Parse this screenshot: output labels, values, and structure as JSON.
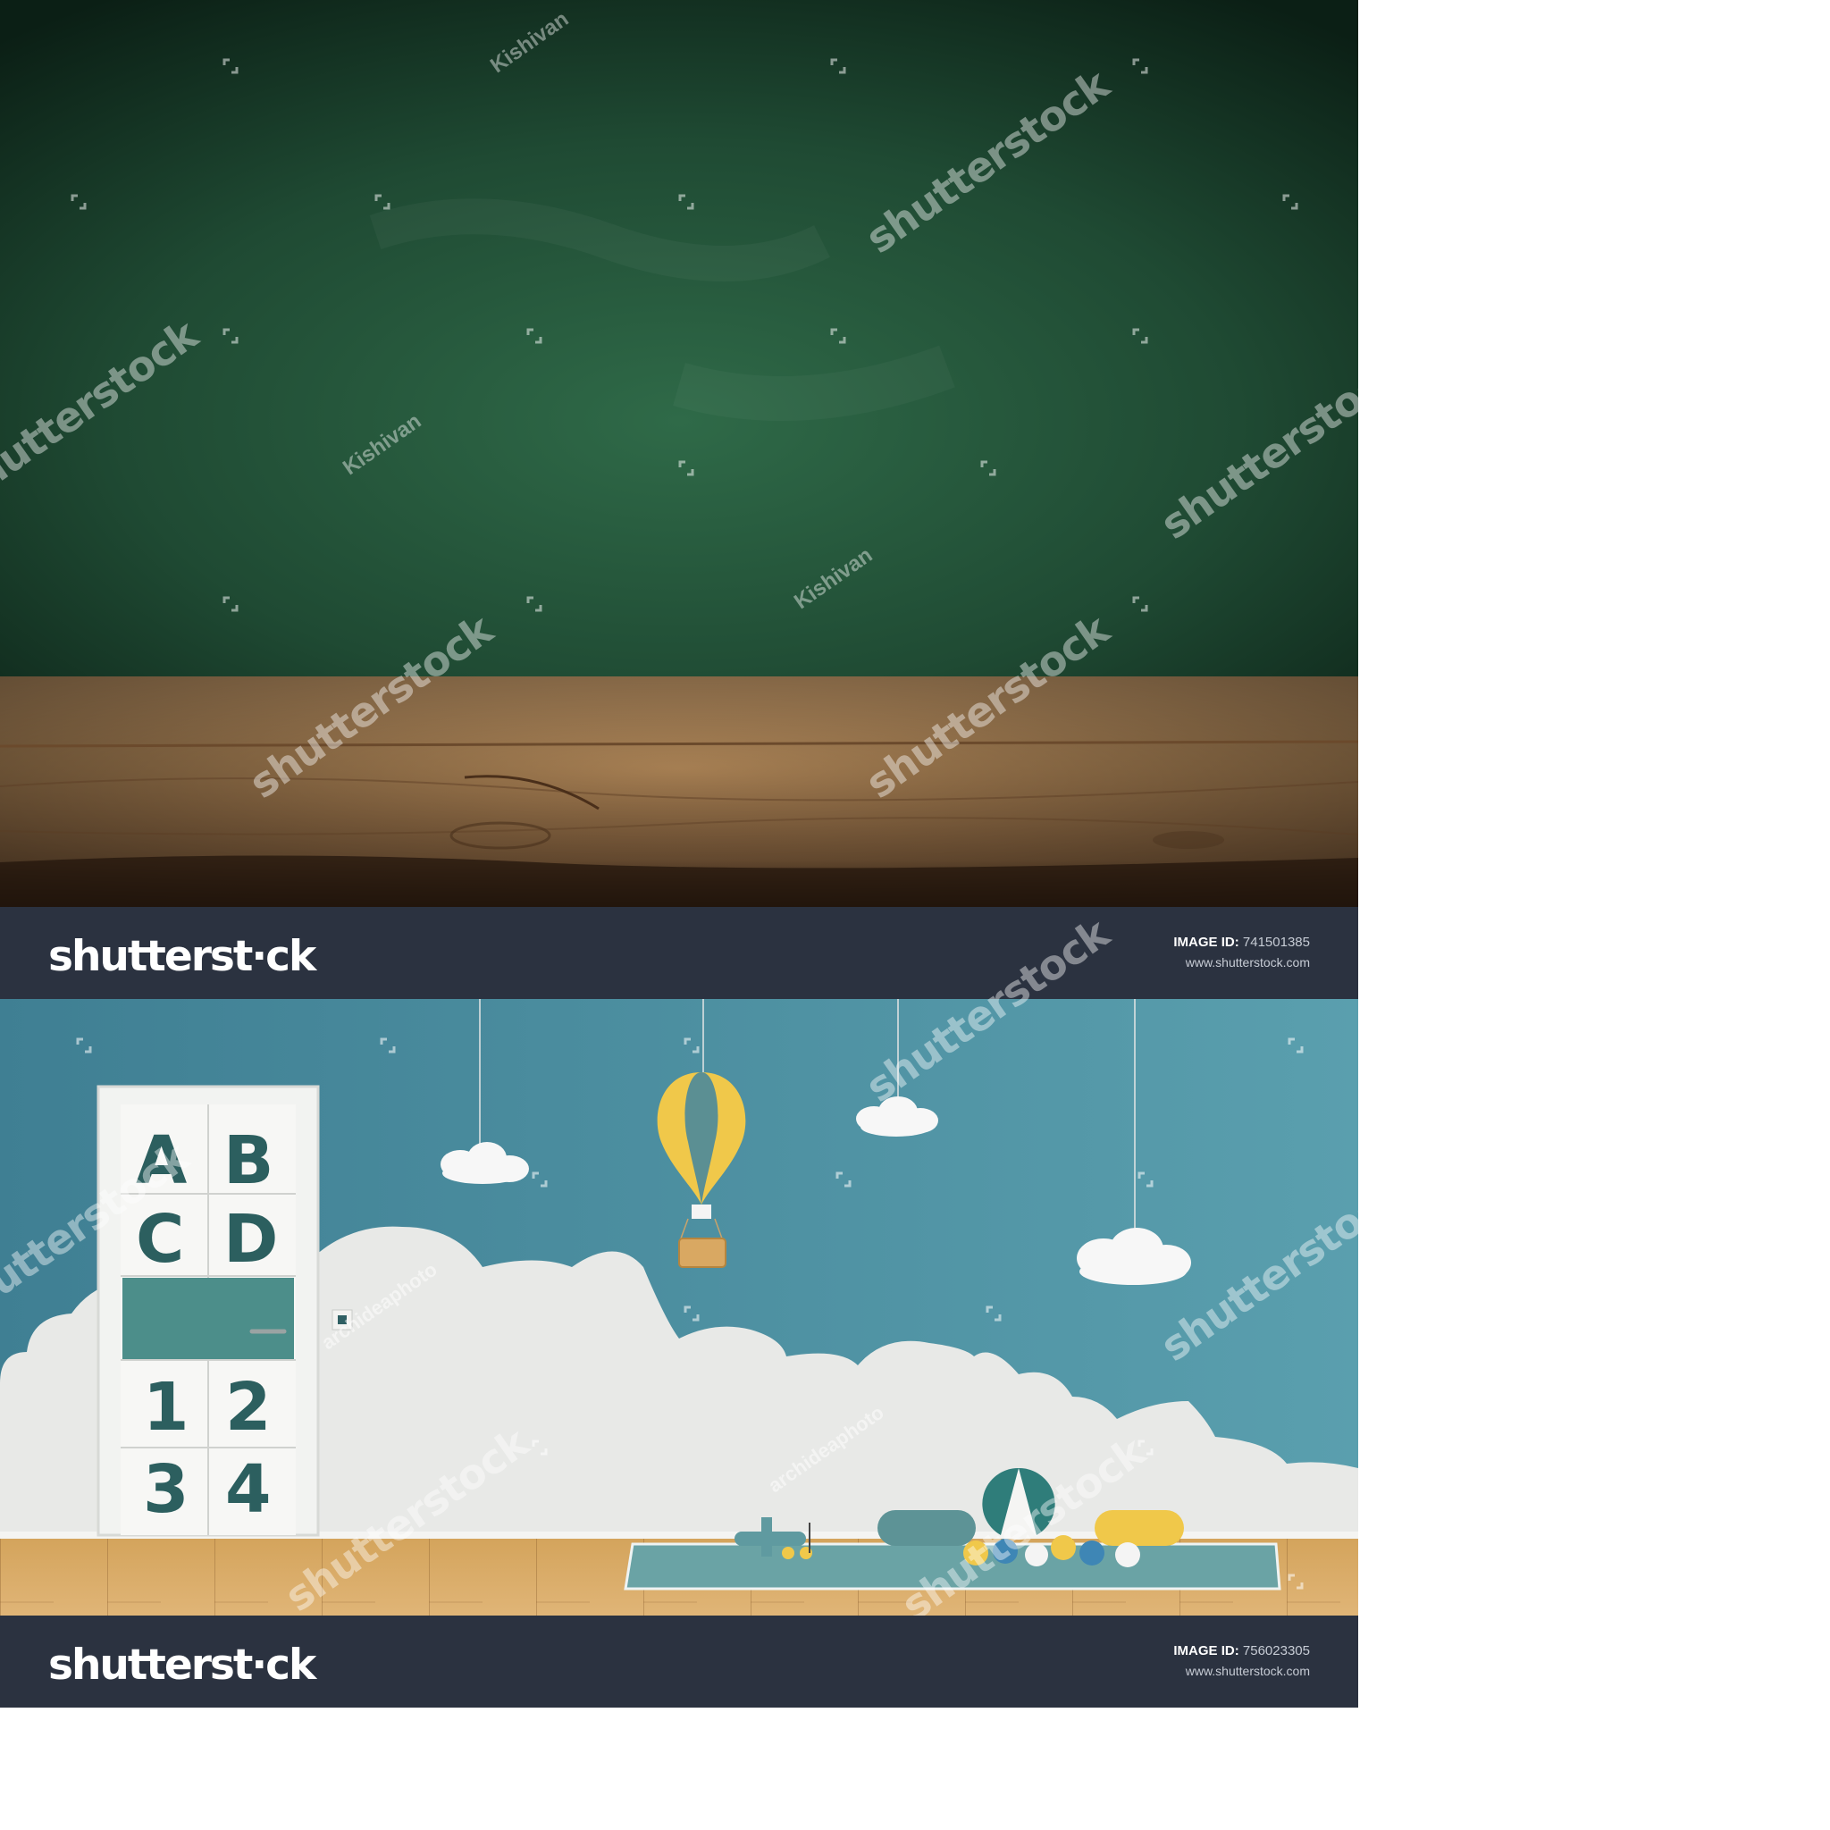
{
  "images": [
    {
      "watermark": {
        "brand": "shutterstock",
        "contributor": "Kishivan"
      },
      "footer": {
        "logo_text": "shutterst⋅ck",
        "id_label": "IMAGE ID:",
        "id_value": "741501385",
        "url": "www.shutterstock.com"
      }
    },
    {
      "watermark": {
        "brand": "shutterstock",
        "contributor": "archideaphoto"
      },
      "door_letters": [
        "A",
        "B",
        "C",
        "D",
        "1",
        "2",
        "3",
        "4"
      ],
      "footer": {
        "logo_text": "shutterst⋅ck",
        "id_label": "IMAGE ID:",
        "id_value": "756023305",
        "url": "www.shutterstock.com"
      }
    }
  ],
  "colors": {
    "chalkboard": "#23523a",
    "wood": "#a8835a",
    "teal_wall": "#4c8fa0",
    "cloud_white": "#e9ebea",
    "floor": "#d9ab63",
    "footer_bg": "#2b3240",
    "yellow": "#f0c84a"
  }
}
